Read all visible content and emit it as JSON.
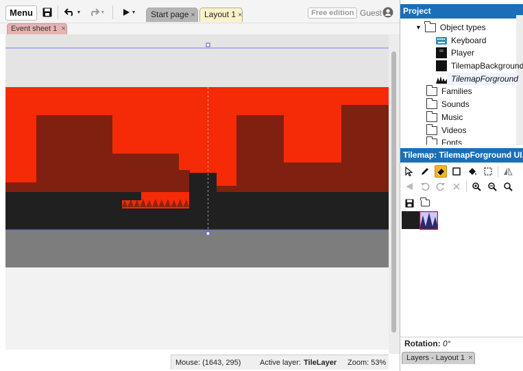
{
  "toolbar": {
    "menu_label": "Menu",
    "edition_label": "Free edition",
    "user_label": "Guest"
  },
  "tabs": [
    {
      "label": "Start page",
      "close": "×"
    },
    {
      "label": "Layout 1",
      "close": "×"
    }
  ],
  "subtabs": [
    {
      "label": "Event sheet 1",
      "close": "×"
    }
  ],
  "status": {
    "mouse_label": "Mouse: (1643, 295)",
    "layer_prefix": "Active layer:",
    "layer_value": "TileLayer",
    "zoom_label": "Zoom: 53%"
  },
  "project": {
    "title": "Project",
    "object_types_label": "Object types",
    "objects": [
      {
        "label": "Keyboard",
        "icon": "keyboard-icon"
      },
      {
        "label": "Player",
        "icon": "sprite-icon"
      },
      {
        "label": "TilemapBackground",
        "icon": "tilemap-icon"
      },
      {
        "label": "TilemapForground",
        "icon": "tilemap-fg-icon",
        "italic": true
      }
    ],
    "folders": [
      "Families",
      "Sounds",
      "Music",
      "Videos",
      "Fonts"
    ]
  },
  "tilemap_panel": {
    "title": "Tilemap: TilemapForground UI..."
  },
  "rotation": {
    "label": "Rotation:",
    "value": "0°"
  },
  "bottom_tab": {
    "label": "Layers - Layout 1",
    "close": "×"
  },
  "colors": {
    "sky": "#f52a07",
    "building": "#7f2011",
    "ground": "#202020",
    "floor": "#7d7d7d",
    "accent": "#1a6fb8",
    "selected_tool": "#f0b428"
  }
}
